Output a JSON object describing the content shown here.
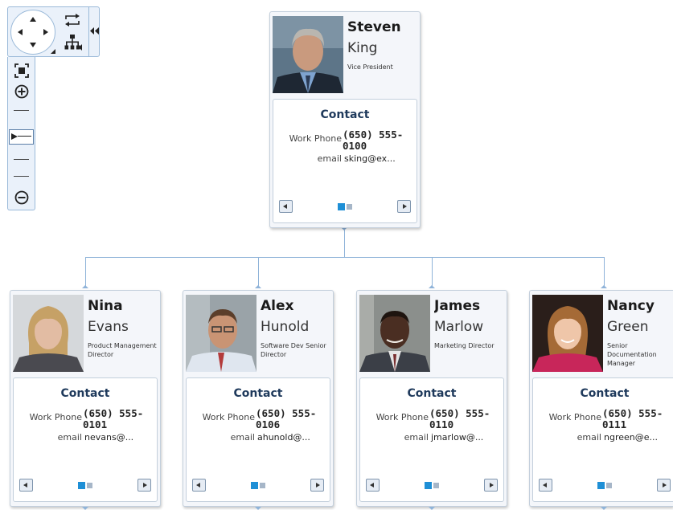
{
  "nav": {
    "pan_icons": [
      "pan-up-icon",
      "pan-down-icon",
      "pan-left-icon",
      "pan-right-icon"
    ],
    "rotate_icon": "rotate-icon",
    "layout_icon": "hierarchy-layout-icon",
    "collapse_icon": "collapse-panel-icon",
    "zoom_to_fit_icon": "zoom-to-fit-icon",
    "zoom_in_icon": "zoom-in-icon",
    "zoom_out_icon": "zoom-out-icon",
    "zoom_level_marker": 2
  },
  "colors": {
    "connector": "#8fb3d9",
    "contact_title": "#1f3a5c",
    "pager_active": "#1e8fd6",
    "pager_inactive": "#a6b6c8",
    "card_bg": "#f4f6fa"
  },
  "contact_title": "Contact",
  "labels": {
    "work_phone": "Work Phone",
    "email": "email"
  },
  "root": {
    "first": "Steven",
    "last": "King",
    "title": "Vice President",
    "phone": "(650) 555-0100",
    "email": "sking@ex...",
    "photo": "photo-steven-king",
    "page": 1,
    "pages": 2
  },
  "children": [
    {
      "first": "Nina",
      "last": "Evans",
      "title": "Product Management Director",
      "phone": "(650) 555-0101",
      "email": "nevans@...",
      "photo": "photo-nina-evans",
      "page": 1,
      "pages": 2
    },
    {
      "first": "Alex",
      "last": "Hunold",
      "title": "Software Dev Senior Director",
      "phone": "(650) 555-0106",
      "email": "ahunold@...",
      "photo": "photo-alex-hunold",
      "page": 1,
      "pages": 2
    },
    {
      "first": "James",
      "last": "Marlow",
      "title": "Marketing Director",
      "phone": "(650) 555-0110",
      "email": "jmarlow@...",
      "photo": "photo-james-marlow",
      "page": 1,
      "pages": 2
    },
    {
      "first": "Nancy",
      "last": "Green",
      "title": "Senior Documentation Manager",
      "phone": "(650) 555-0111",
      "email": "ngreen@e...",
      "photo": "photo-nancy-green",
      "page": 1,
      "pages": 2
    }
  ]
}
